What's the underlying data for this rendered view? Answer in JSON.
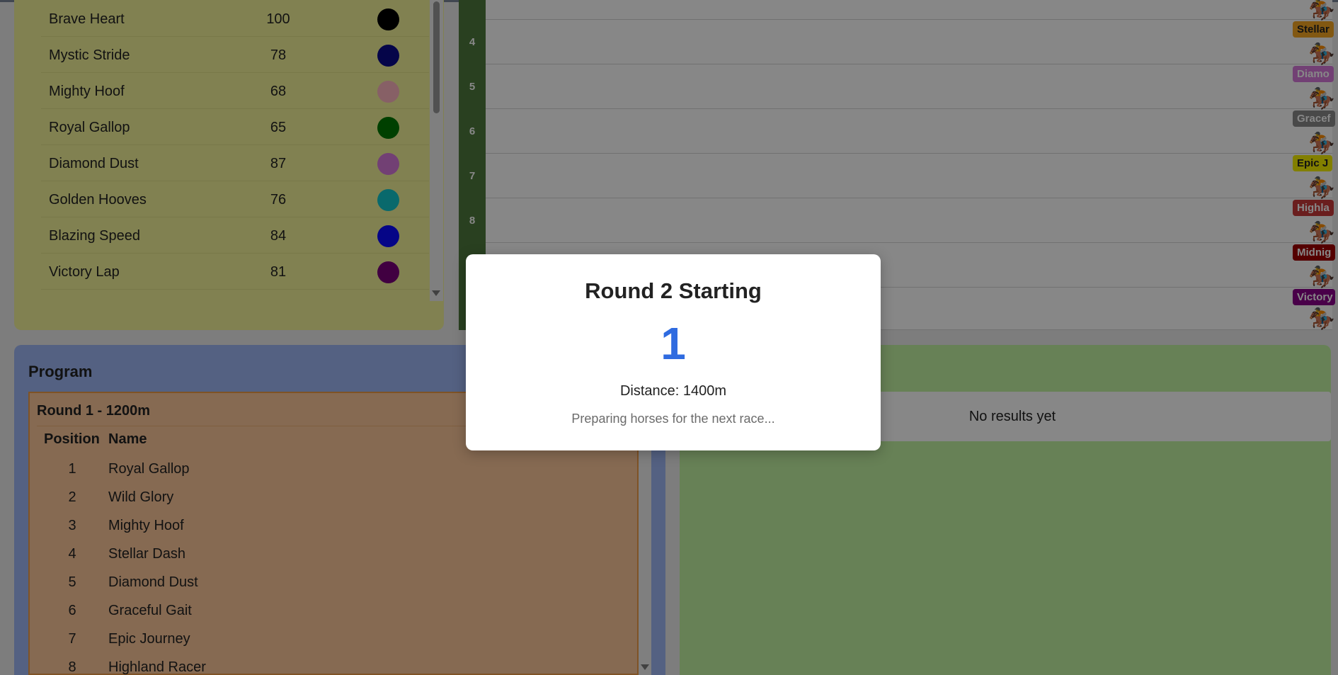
{
  "horses": [
    {
      "name": "Brave Heart",
      "condition": "100",
      "color": "#000000"
    },
    {
      "name": "Mystic Stride",
      "condition": "78",
      "color": "#0a0a8a"
    },
    {
      "name": "Mighty Hoof",
      "condition": "68",
      "color": "#ffb6c1"
    },
    {
      "name": "Royal Gallop",
      "condition": "65",
      "color": "#007a00"
    },
    {
      "name": "Diamond Dust",
      "condition": "87",
      "color": "#d87adc"
    },
    {
      "name": "Golden Hooves",
      "condition": "76",
      "color": "#11c7cc"
    },
    {
      "name": "Blazing Speed",
      "condition": "84",
      "color": "#0a0aff"
    },
    {
      "name": "Victory Lap",
      "condition": "81",
      "color": "#7c007c"
    }
  ],
  "track": {
    "lanes": [
      {
        "number": "4",
        "label": "Stellar",
        "label_color": "#f5a623"
      },
      {
        "number": "5",
        "label": "Diamo",
        "label_color": "#d87adc"
      },
      {
        "number": "6",
        "label": "Gracef",
        "label_color": "#8a8a8a"
      },
      {
        "number": "7",
        "label": "Epic J",
        "label_color": "#f5f000"
      },
      {
        "number": "8",
        "label": "Highla",
        "label_color": "#c9393a"
      },
      {
        "number": "",
        "label": "Midnig",
        "label_color": "#a00000"
      },
      {
        "number": "",
        "label": "Victory",
        "label_color": "#8a008a"
      }
    ]
  },
  "program": {
    "title": "Program",
    "round_title": "Round 1 - 1200m",
    "col_position": "Position",
    "col_name": "Name",
    "rows": [
      {
        "position": "1",
        "name": "Royal Gallop"
      },
      {
        "position": "2",
        "name": "Wild Glory"
      },
      {
        "position": "3",
        "name": "Mighty Hoof"
      },
      {
        "position": "4",
        "name": "Stellar Dash"
      },
      {
        "position": "5",
        "name": "Diamond Dust"
      },
      {
        "position": "6",
        "name": "Graceful Gait"
      },
      {
        "position": "7",
        "name": "Epic Journey"
      },
      {
        "position": "8",
        "name": "Highland Racer"
      }
    ]
  },
  "results": {
    "empty_text": "No results yet"
  },
  "modal": {
    "title": "Round 2 Starting",
    "countdown": "1",
    "distance": "Distance: 1400m",
    "subtitle": "Preparing horses for the next race..."
  },
  "horse_glyph": "🏇"
}
